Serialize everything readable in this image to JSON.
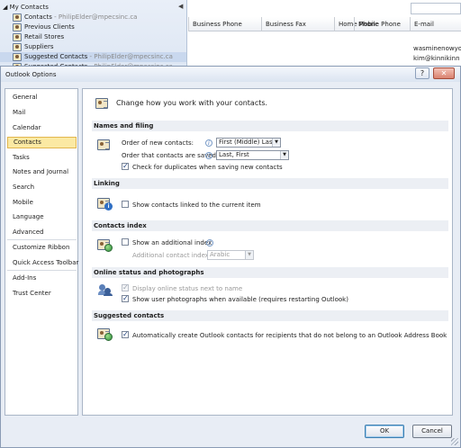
{
  "background": {
    "folder": "My Contacts",
    "nav_items": [
      {
        "label": "Contacts",
        "sub": " - PhilipElder@mpecsinc.ca"
      },
      {
        "label": "Previous Clients",
        "sub": ""
      },
      {
        "label": "Retail Stores",
        "sub": ""
      },
      {
        "label": "Suppliers",
        "sub": ""
      },
      {
        "label": "Suggested Contacts",
        "sub": " - PhilipElder@mpecsinc.ca"
      },
      {
        "label": "Suggested Contacts",
        "sub": " - PhilipElder@mpecsinc.ca"
      }
    ],
    "columns": [
      "Business Phone",
      "Business Fax",
      "Home Phone",
      "Mobile Phone",
      "E-mail"
    ],
    "emails": [
      "wasminenowyo",
      "kim@kinnikinn"
    ]
  },
  "dialog": {
    "title": "Outlook Options",
    "help_glyph": "?",
    "close_glyph": "✕",
    "sidebar": [
      "General",
      "Mail",
      "Calendar",
      "Contacts",
      "Tasks",
      "Notes and Journal",
      "Search",
      "Mobile",
      "Language",
      "Advanced",
      "Customize Ribbon",
      "Quick Access Toolbar",
      "Add-Ins",
      "Trust Center"
    ],
    "selected": "Contacts",
    "intro": "Change how you work with your contacts.",
    "names": {
      "header": "Names and filing",
      "order_new_label": "Order of new contacts:",
      "order_new_value": "First (Middle) Last",
      "order_saved_label": "Order that contacts are saved:",
      "order_saved_value": "Last, First",
      "check_dup": "Check for duplicates when saving new contacts"
    },
    "linking": {
      "header": "Linking",
      "show_linked": "Show contacts linked to the current item"
    },
    "index": {
      "header": "Contacts index",
      "show_additional": "Show an additional index",
      "additional_label": "Additional contact index:",
      "additional_value": "Arabic"
    },
    "online": {
      "header": "Online status and photographs",
      "display_status": "Display online status next to name",
      "show_photos": "Show user photographs when available (requires restarting Outlook)"
    },
    "suggested": {
      "header": "Suggested contacts",
      "auto_create": "Automatically create Outlook contacts for recipients that do not belong to an Outlook Address Book"
    },
    "ok": "OK",
    "cancel": "Cancel",
    "info_glyph": "i",
    "dropdown_glyph": "▼"
  }
}
